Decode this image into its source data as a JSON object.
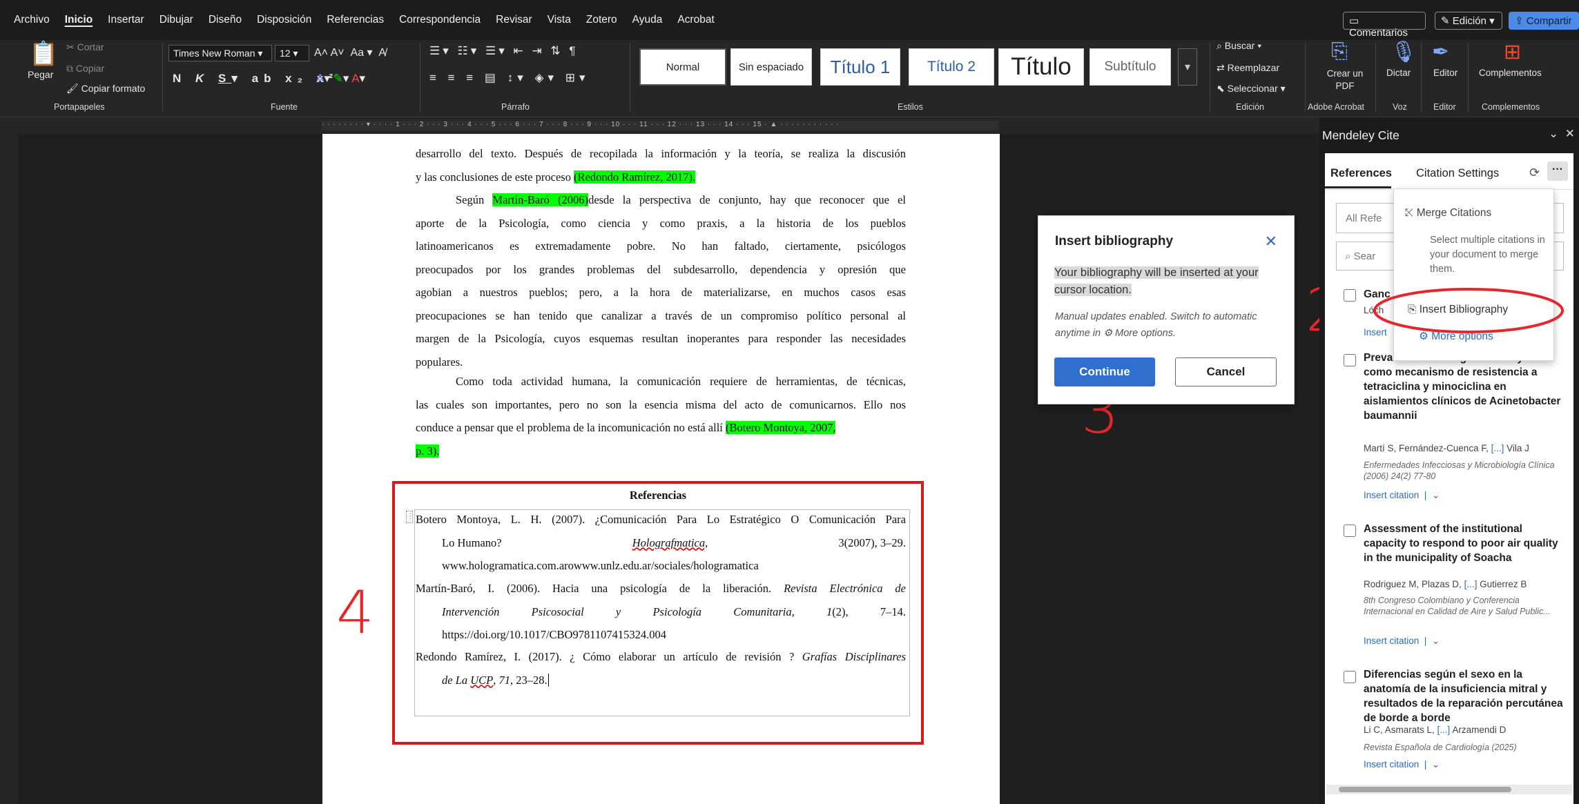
{
  "menubar": {
    "items": [
      "Archivo",
      "Inicio",
      "Insertar",
      "Dibujar",
      "Diseño",
      "Disposición",
      "Referencias",
      "Correspondencia",
      "Revisar",
      "Vista",
      "Zotero",
      "Ayuda",
      "Acrobat"
    ],
    "comments": "Comentarios",
    "editing": "Edición",
    "share": "Compartir"
  },
  "ribbon": {
    "clipboard": {
      "paste": "Pegar",
      "cut": "Cortar",
      "copy": "Copiar",
      "format_painter": "Copiar formato",
      "label": "Portapapeles"
    },
    "font": {
      "name": "Times New Roman",
      "size": "12",
      "label": "Fuente"
    },
    "paragraph": {
      "label": "Párrafo"
    },
    "styles": {
      "items": [
        "Normal",
        "Sin espaciado",
        "Título 1",
        "Título 2",
        "Título",
        "Subtítulo"
      ],
      "label": "Estilos"
    },
    "editing": {
      "find": "Buscar",
      "replace": "Reemplazar",
      "select": "Seleccionar",
      "label": "Edición"
    },
    "acrobat": {
      "create": "Crear un PDF",
      "label": "Adobe Acrobat"
    },
    "voice": {
      "dictate": "Dictar",
      "label": "Voz"
    },
    "editor": {
      "editor": "Editor",
      "label": "Editor"
    },
    "addins": {
      "addins": "Complementos",
      "label": "Complementos"
    }
  },
  "document": {
    "p1": [
      "desarrollo del texto. Después de recopilada la información y la teoría, se realiza la discusión",
      "y las conclusiones de este proceso ",
      "(Redondo Ramírez, 2017)."
    ],
    "p2_lead": "Según ",
    "p2_cite": "Martín-Baró (2006)",
    "p2_lines": [
      "desde la perspectiva de conjunto, hay que reconocer que el",
      "aporte de la Psicología, como ciencia y como praxis, a la historia de los pueblos",
      "latinoamericanos es extremadamente pobre. No han faltado, ciertamente, psicólogos",
      "preocupados por los grandes problemas del subdesarrollo, dependencia y opresión que",
      "agobian a nuestros pueblos; pero, a la hora de materializarse, en muchos casos esas",
      "preocupaciones se han tenido que canalizar a través de un compromiso político personal al",
      "margen de la Psicología, cuyos esquemas resultan inoperantes para responder las necesidades",
      "populares."
    ],
    "p3_lines": [
      "Como toda actividad humana, la comunicación requiere de herramientas, de técnicas,",
      "las cuales son importantes, pero no son la esencia misma del acto de comunicarnos. Ello nos",
      "conduce a pensar que el problema de la incomunicación no está allí "
    ],
    "p3_cite": "(Botero Montoya, 2007,",
    "p3_cite2": "p. 3).",
    "refs_heading": "Referencias",
    "ref1": [
      "Botero Montoya, L. H. (2007). ¿Comunicación Para Lo Estratégico O Comunicación Para",
      "Lo Humano? ",
      "Holografmatica,",
      " 3(2007), 3–29.",
      "www.hologramatica.com.arowww.unlz.edu.ar/sociales/hologramatica"
    ],
    "ref2": [
      "Martín-Baró, I. (2006). Hacia una psicología de la liberación. ",
      "Revista Electrónica de",
      "Intervención Psicosocial y Psicología Comunitaria, ",
      "1",
      "(2), 7–14.",
      "https://doi.org/10.1017/CBO9781107415324.004"
    ],
    "ref3": [
      "Redondo Ramírez, I. (2017). ¿ Cómo elaborar un artículo de revisión ? ",
      "Grafías Disciplinares",
      "de La ",
      "UCP",
      ", ",
      "71",
      ", 23–28."
    ]
  },
  "annotations": {
    "a2": "2",
    "a3": "3",
    "a4": "4"
  },
  "dialog": {
    "title": "Insert bibliography",
    "message": "Your bibliography will be inserted at your cursor location.",
    "note_a": "Manual updates enabled. Switch to automatic anytime in ",
    "note_b": " More options.",
    "continue": "Continue",
    "cancel": "Cancel"
  },
  "mendeley": {
    "title": "Mendeley Cite",
    "tabs": [
      "References",
      "Citation Settings"
    ],
    "filter": "All Refe",
    "search_placeholder": "Sear",
    "menu": {
      "merge": "Merge Citations",
      "merge_desc": "Select multiple citations in your document to merge them.",
      "insert_bib": "Insert Bibliography",
      "more": "More options"
    },
    "partial": {
      "title": "Ganc",
      "auth": "Lóch",
      "link": "Insert"
    },
    "refs": [
      {
        "title": "Prevalencia de los genes tetA y tetB como mecanismo de resistencia a tetraciclina y minociclina en aislamientos clínicos de Acinetobacter baumannii",
        "authors_a": "Martí S, Fernández-Cuenca F, ",
        "authors_b": "[...]",
        "authors_c": " Vila J",
        "source": "Enfermedades Infecciosas y Microbiología Clínica (2006) 24(2) 77-80",
        "link": "Insert citation"
      },
      {
        "title": "Assessment of the institutional capacity to respond to poor air quality in the municipality of Soacha",
        "authors_a": "Rodriguez M, Plazas D, ",
        "authors_b": "[...]",
        "authors_c": " Gutierrez B",
        "source": "8th Congreso Colombiano y Conferencia Internacional en Calidad de Aire y Salud Public...",
        "link": "Insert citation"
      },
      {
        "title": "Diferencias según el sexo en la anatomía de la insuficiencia mitral y resultados de la reparación percutánea de borde a borde",
        "authors_a": "Li C, Asmarats L, ",
        "authors_b": "[...]",
        "authors_c": " Arzamendi D",
        "source": "Revista Española de Cardiología (2025)",
        "link": "Insert citation"
      }
    ]
  },
  "colors": {
    "highlight": "#00ff00",
    "annotation": "#e6262b",
    "accent": "#2f6fd0"
  }
}
